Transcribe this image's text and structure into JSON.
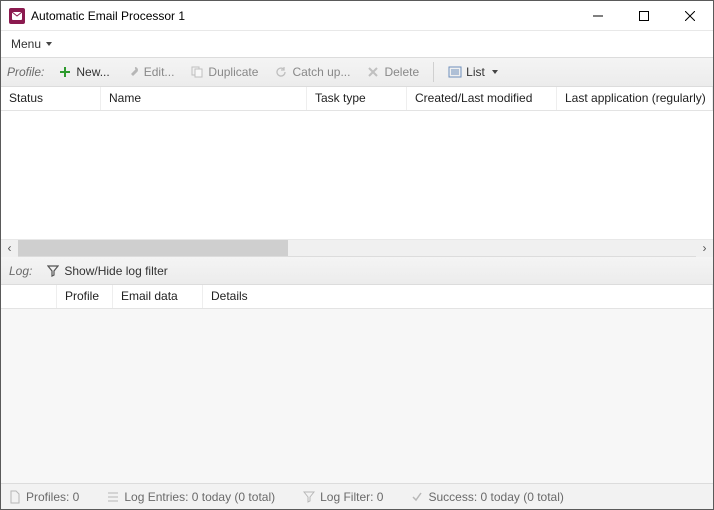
{
  "window": {
    "title": "Automatic Email Processor 1"
  },
  "menubar": {
    "menu": "Menu"
  },
  "toolbar": {
    "profile_label": "Profile:",
    "new": "New...",
    "edit": "Edit...",
    "duplicate": "Duplicate",
    "catch_up": "Catch up...",
    "delete": "Delete",
    "list": "List"
  },
  "profiles_table": {
    "columns": {
      "status": "Status",
      "name": "Name",
      "task_type": "Task type",
      "created_modified": "Created/Last modified",
      "last_application": "Last application (regularly)"
    }
  },
  "log_toolbar": {
    "label": "Log:",
    "showhide": "Show/Hide log filter"
  },
  "log_table": {
    "columns": {
      "icon": "",
      "profile": "Profile",
      "email_data": "Email data",
      "details": "Details"
    }
  },
  "statusbar": {
    "profiles": "Profiles: 0",
    "log_entries": "Log Entries: 0 today (0 total)",
    "log_filter": "Log Filter: 0",
    "success": "Success: 0 today (0 total)"
  }
}
